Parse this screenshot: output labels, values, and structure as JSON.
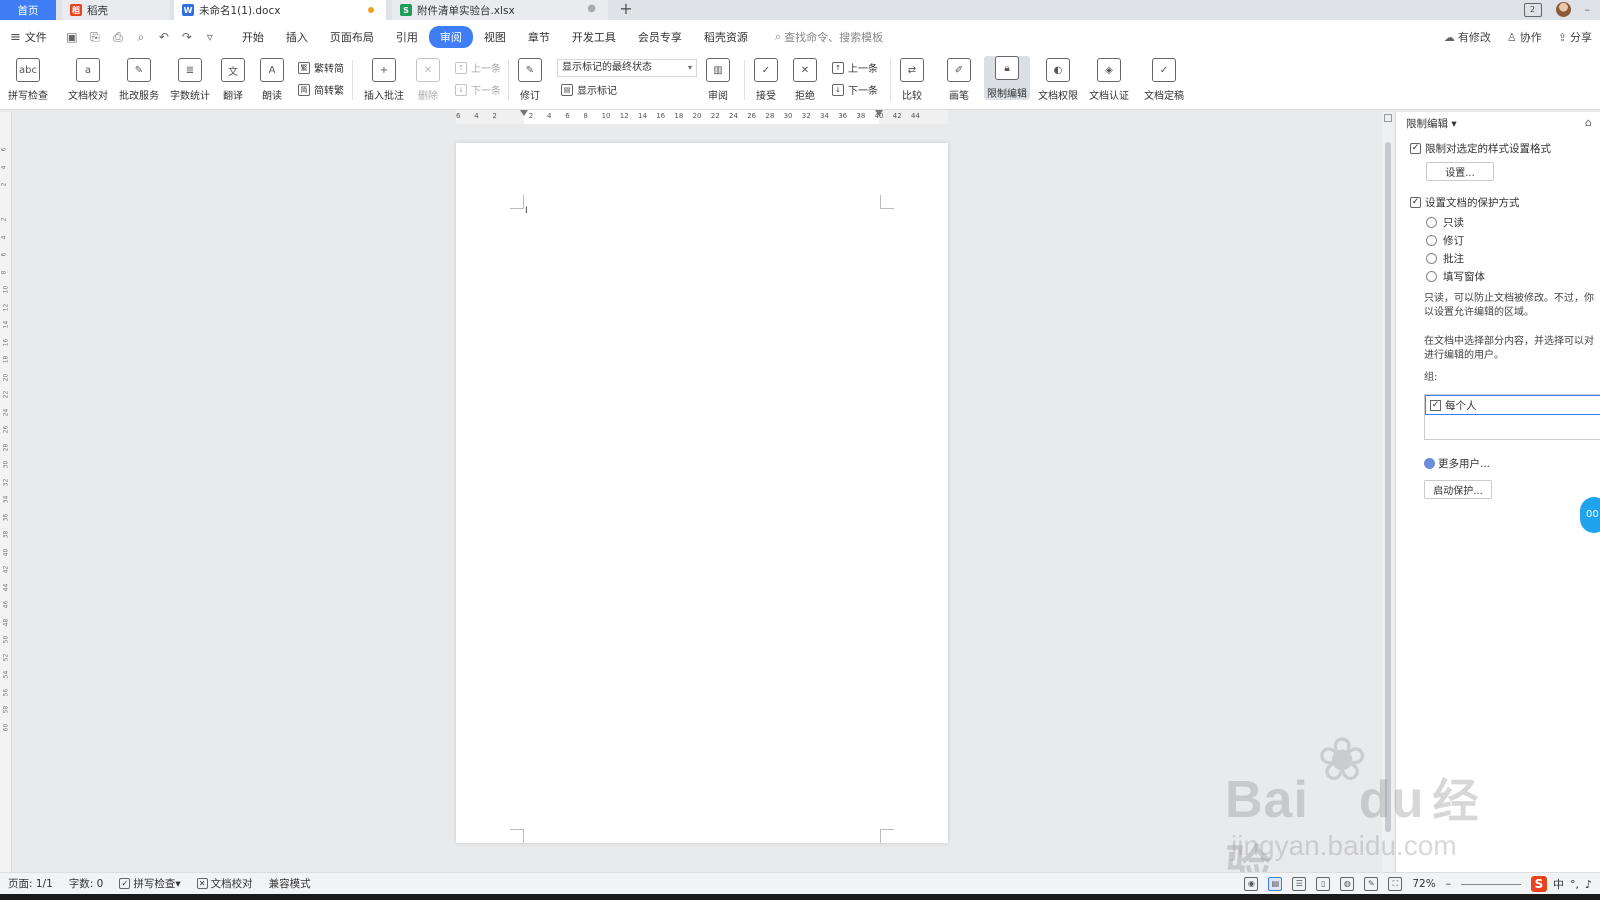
{
  "tabs": [
    {
      "label": "首页"
    },
    {
      "label": "稻壳"
    },
    {
      "label": "未命名1(1).docx"
    },
    {
      "label": "附件清单实验台.xlsx"
    }
  ],
  "menu": {
    "file": "文件",
    "tabs": [
      "开始",
      "插入",
      "页面布局",
      "引用",
      "审阅",
      "视图",
      "章节",
      "开发工具",
      "会员专享",
      "稻壳资源"
    ],
    "active_tab": "审阅",
    "search_placeholder": "查找命令、搜索模板",
    "right": {
      "modified": "有修改",
      "collab": "协作",
      "share": "分享"
    }
  },
  "ribbon": {
    "spell_check": "拼写检查",
    "doc_proof": "文档校对",
    "review_service": "批改服务",
    "word_count": "字数统计",
    "translate": "翻译",
    "read_aloud": "朗读",
    "trad_to_simp": "繁转简",
    "simp_to_trad": "简转繁",
    "insert_comment": "插入批注",
    "delete": "删除",
    "prev_comment": "上一条",
    "next_comment": "下一条",
    "revise": "修订",
    "markup_state": "显示标记的最终状态",
    "show_markup": "显示标记",
    "review": "审阅",
    "accept": "接受",
    "reject": "拒绝",
    "prev_change": "上一条",
    "next_change": "下一条",
    "compare": "比较",
    "pen": "画笔",
    "restrict_edit": "限制编辑",
    "doc_rights": "文档权限",
    "doc_cert": "文档认证",
    "doc_finalize": "文档定稿"
  },
  "ruler_ticks": [
    "6",
    "4",
    "2",
    "",
    "2",
    "4",
    "6",
    "8",
    "10",
    "12",
    "14",
    "16",
    "18",
    "20",
    "22",
    "24",
    "26",
    "28",
    "30",
    "32",
    "34",
    "36",
    "38",
    "40",
    "42",
    "44"
  ],
  "vruler_ticks": [
    "6",
    "4",
    "2",
    "",
    "2",
    "4",
    "6",
    "8",
    "10",
    "12",
    "14",
    "16",
    "18",
    "20",
    "22",
    "24",
    "26",
    "28",
    "30",
    "32",
    "34",
    "36",
    "38",
    "40",
    "42",
    "44",
    "46",
    "48",
    "50",
    "52",
    "54",
    "56",
    "58",
    "60"
  ],
  "panel": {
    "title": "限制编辑",
    "format_restrict": "限制对选定的样式设置格式",
    "settings_button": "设置...",
    "protect_method": "设置文档的保护方式",
    "options": [
      "只读",
      "修订",
      "批注",
      "填写窗体"
    ],
    "desc1_line1": "只读，可以防止文档被修改。不过，你",
    "desc1_line2": "以设置允许编辑的区域。",
    "desc2_line1": "在文档中选择部分内容，并选择可以对",
    "desc2_line2": "进行编辑的用户。",
    "group_label": "组:",
    "group_everyone": "每个人",
    "more_users": "更多用户...",
    "start_protect": "启动保护...",
    "bubble": "00"
  },
  "status": {
    "page": "页面: 1/1",
    "word_count": "字数: 0",
    "spell_check": "拼写检查",
    "doc_proof": "文档校对",
    "compat_mode": "兼容模式",
    "zoom": "72%",
    "ime_lang": "中"
  },
  "watermark": {
    "brand": "Bai",
    "brand2": "du",
    "brand_cn": "经验",
    "url": "jingyan.baidu.com"
  }
}
